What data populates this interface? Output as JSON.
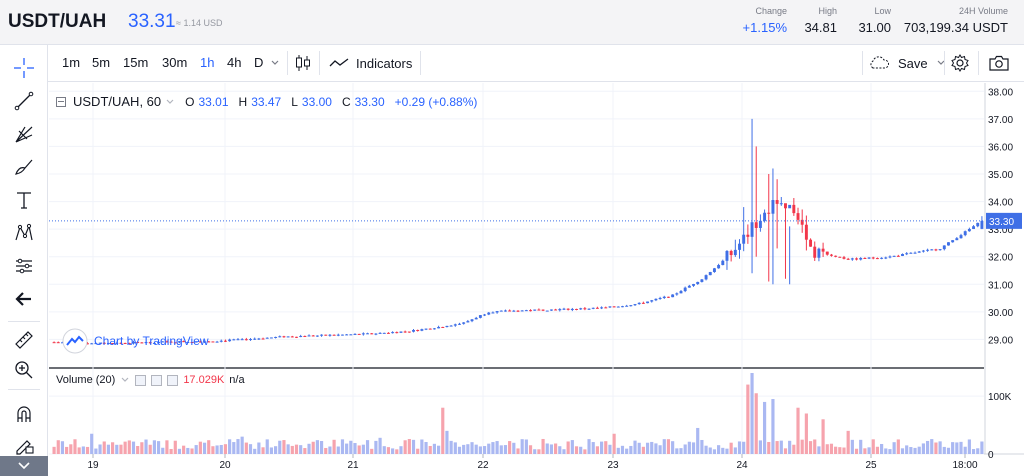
{
  "header": {
    "pair": "USDT/UAH",
    "price": "33.31",
    "usd": "≈ 1.14 USD",
    "stats": [
      {
        "label": "Change",
        "value": "+1.15%",
        "up": true
      },
      {
        "label": "High",
        "value": "34.81",
        "up": false
      },
      {
        "label": "Low",
        "value": "31.00",
        "up": false
      },
      {
        "label": "24H Volume",
        "value": "703,199.34 USDT",
        "up": false
      }
    ]
  },
  "toolbar": {
    "timeframes": [
      "1m",
      "5m",
      "15m",
      "30m",
      "1h",
      "4h",
      "D"
    ],
    "active_timeframe": "1h",
    "indicators_label": "Indicators",
    "save_label": "Save"
  },
  "legend": {
    "symbol": "USDT/UAH, 60",
    "open_label": "O",
    "open": "33.01",
    "high_label": "H",
    "high": "33.47",
    "low_label": "L",
    "low": "33.00",
    "close_label": "C",
    "close": "33.30",
    "change": "+0.29 (+0.88%)"
  },
  "volume_legend": {
    "label": "Volume (20)",
    "value": "17.029K",
    "na": "n/a"
  },
  "watermark": "Chart by TradingView",
  "colors": {
    "up": "#3f6fe6",
    "down": "#f2364a",
    "up_volume": "#aab8f2",
    "down_volume": "#f6a3ad",
    "accent": "#2962ff"
  },
  "chart_data": {
    "type": "candlestick",
    "price_axis": {
      "ticks": [
        "29.00",
        "30.00",
        "31.00",
        "32.00",
        "33.00",
        "34.00",
        "35.00",
        "36.00",
        "37.00",
        "38.00"
      ],
      "range": [
        28.0,
        38.3
      ]
    },
    "current_price_label": "33.30",
    "volume_axis": {
      "ticks": [
        "0",
        "100K"
      ],
      "range": [
        0,
        140000
      ]
    },
    "x_labels": [
      "19",
      "20",
      "21",
      "22",
      "23",
      "24",
      "25",
      "18:00"
    ],
    "grid": true,
    "anchors": [
      [
        0,
        28.9
      ],
      [
        10,
        28.85
      ],
      [
        25,
        28.9
      ],
      [
        40,
        28.95
      ],
      [
        55,
        29.1
      ],
      [
        65,
        29.15
      ],
      [
        75,
        29.2
      ],
      [
        85,
        29.3
      ],
      [
        92,
        29.45
      ],
      [
        98,
        29.6
      ],
      [
        104,
        30.0
      ],
      [
        112,
        30.05
      ],
      [
        124,
        30.1
      ],
      [
        132,
        30.15
      ],
      [
        140,
        30.3
      ],
      [
        148,
        30.6
      ],
      [
        155,
        31.2
      ],
      [
        162,
        32.1
      ],
      [
        168,
        33.2
      ],
      [
        173,
        34.1
      ],
      [
        178,
        33.5
      ],
      [
        182,
        32.2
      ],
      [
        190,
        31.9
      ],
      [
        200,
        32.0
      ],
      [
        212,
        32.3
      ],
      [
        217,
        32.8
      ],
      [
        222,
        33.3
      ]
    ],
    "spikes": [
      {
        "i": 165,
        "h": 33.8,
        "l": 32.2
      },
      {
        "i": 167,
        "h": 37.0,
        "l": 31.4
      },
      {
        "i": 168,
        "h": 36.0,
        "l": 32.0
      },
      {
        "i": 171,
        "h": 35.0,
        "l": 31.1
      },
      {
        "i": 172,
        "h": 35.2,
        "l": 31.0
      },
      {
        "i": 173,
        "h": 34.81,
        "l": 32.3
      },
      {
        "i": 175,
        "h": 33.9,
        "l": 31.2
      },
      {
        "i": 176,
        "h": 33.1,
        "l": 31.0
      }
    ],
    "volume_bursts": [
      {
        "i": 9,
        "v": 35000
      },
      {
        "i": 22,
        "v": 25000
      },
      {
        "i": 45,
        "v": 30000
      },
      {
        "i": 78,
        "v": 28000
      },
      {
        "i": 93,
        "v": 80000
      },
      {
        "i": 94,
        "v": 40000
      },
      {
        "i": 134,
        "v": 35000
      },
      {
        "i": 154,
        "v": 45000
      },
      {
        "i": 166,
        "v": 120000
      },
      {
        "i": 167,
        "v": 140000
      },
      {
        "i": 168,
        "v": 105000
      },
      {
        "i": 170,
        "v": 90000
      },
      {
        "i": 172,
        "v": 95000
      },
      {
        "i": 178,
        "v": 80000
      },
      {
        "i": 180,
        "v": 70000
      },
      {
        "i": 184,
        "v": 60000
      },
      {
        "i": 190,
        "v": 40000
      }
    ],
    "candle_count": 223
  }
}
